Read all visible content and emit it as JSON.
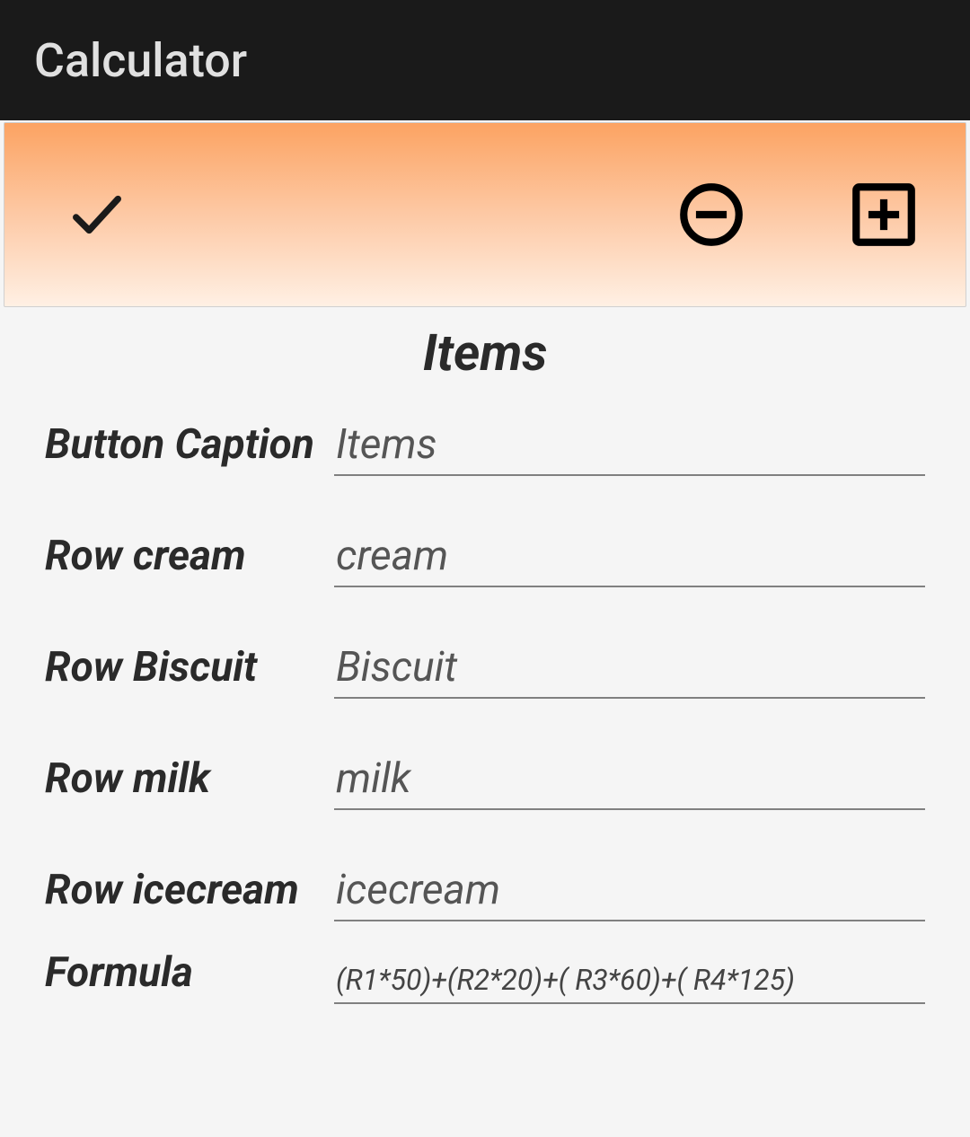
{
  "header": {
    "title": "Calculator"
  },
  "toolbar": {
    "icons": {
      "check": "check-icon",
      "minus": "minus-circle-icon",
      "plus": "plus-square-icon"
    }
  },
  "section": {
    "title": "Items"
  },
  "form": {
    "button_caption": {
      "label": "Button Caption",
      "value": "Items"
    },
    "rows": [
      {
        "label": "Row cream",
        "value": "cream"
      },
      {
        "label": "Row Biscuit",
        "value": "Biscuit"
      },
      {
        "label": "Row milk",
        "value": "milk"
      },
      {
        "label": "Row icecream",
        "value": "icecream"
      }
    ],
    "formula": {
      "label": "Formula",
      "value": "(R1*50)+(R2*20)+( R3*60)+( R4*125)"
    }
  }
}
